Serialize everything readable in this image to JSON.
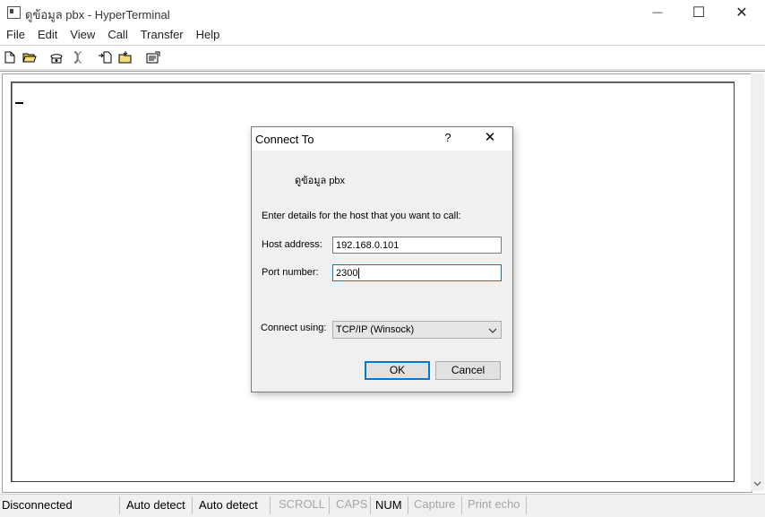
{
  "window": {
    "title": "ดูข้อมูล pbx - HyperTerminal",
    "minimize": "—",
    "maximize": "☐",
    "close": "✕"
  },
  "menu": [
    "File",
    "Edit",
    "View",
    "Call",
    "Transfer",
    "Help"
  ],
  "toolbar": [
    "new-connection",
    "open",
    "dial",
    "disconnect",
    "send",
    "receive",
    "properties"
  ],
  "dialog": {
    "title": "Connect To",
    "help": "?",
    "close": "✕",
    "connection_name": "ดูข้อมูล pbx",
    "instructions": "Enter details for the host that you want to call:",
    "host_label": "Host address:",
    "host_value": "192.168.0.101",
    "port_label": "Port number:",
    "port_value": "2300",
    "connect_label": "Connect using:",
    "connect_value": "TCP/IP (Winsock)",
    "ok": "OK",
    "cancel": "Cancel"
  },
  "status": {
    "connection": "Disconnected",
    "detect1": "Auto detect",
    "detect2": "Auto detect",
    "scroll": "SCROLL",
    "caps": "CAPS",
    "num": "NUM",
    "capture": "Capture",
    "print_echo": "Print echo"
  }
}
